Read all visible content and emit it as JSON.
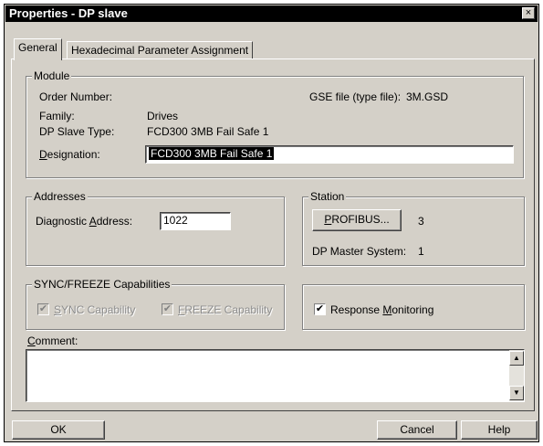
{
  "window": {
    "title": "Properties - DP slave",
    "close_glyph": "×"
  },
  "tabs": [
    {
      "label": "General",
      "active": true
    },
    {
      "label": "Hexadecimal Parameter Assignment",
      "active": false
    }
  ],
  "module": {
    "title": "Module",
    "order_number_label": "Order Number:",
    "order_number_value": "",
    "gse_file_label": "GSE file (type file):",
    "gse_file_value": "3M.GSD",
    "family_label": "Family:",
    "family_value": "Drives",
    "slave_type_label": "DP Slave Type:",
    "slave_type_value": "FCD300 3MB Fail Safe 1",
    "designation_label_first": "D",
    "designation_label_rest": "esignation:",
    "designation_value": "FCD300 3MB Fail Safe 1"
  },
  "addresses": {
    "title": "Addresses",
    "diag_label_before": "Diagnostic ",
    "diag_label_key": "A",
    "diag_label_after": "ddress:",
    "diag_value": "1022"
  },
  "station": {
    "title": "Station",
    "profibus_key": "P",
    "profibus_rest": "ROFIBUS...",
    "profibus_value": "3",
    "master_label": "DP Master System:",
    "master_value": "1"
  },
  "sync_freeze": {
    "title": "SYNC/FREEZE Capabilities",
    "sync_key": "S",
    "sync_rest": "YNC Capability",
    "sync_checked": true,
    "freeze_key": "F",
    "freeze_rest": "REEZE Capability",
    "freeze_checked": true
  },
  "response": {
    "label_before": "Response ",
    "label_key": "M",
    "label_after": "onitoring",
    "checked": true
  },
  "comment": {
    "label_key": "C",
    "label_rest": "omment:",
    "value": ""
  },
  "buttons": {
    "ok": "OK",
    "cancel": "Cancel",
    "help": "Help"
  },
  "check_glyph": "✔",
  "scroll_up_glyph": "▲",
  "scroll_down_glyph": "▼"
}
